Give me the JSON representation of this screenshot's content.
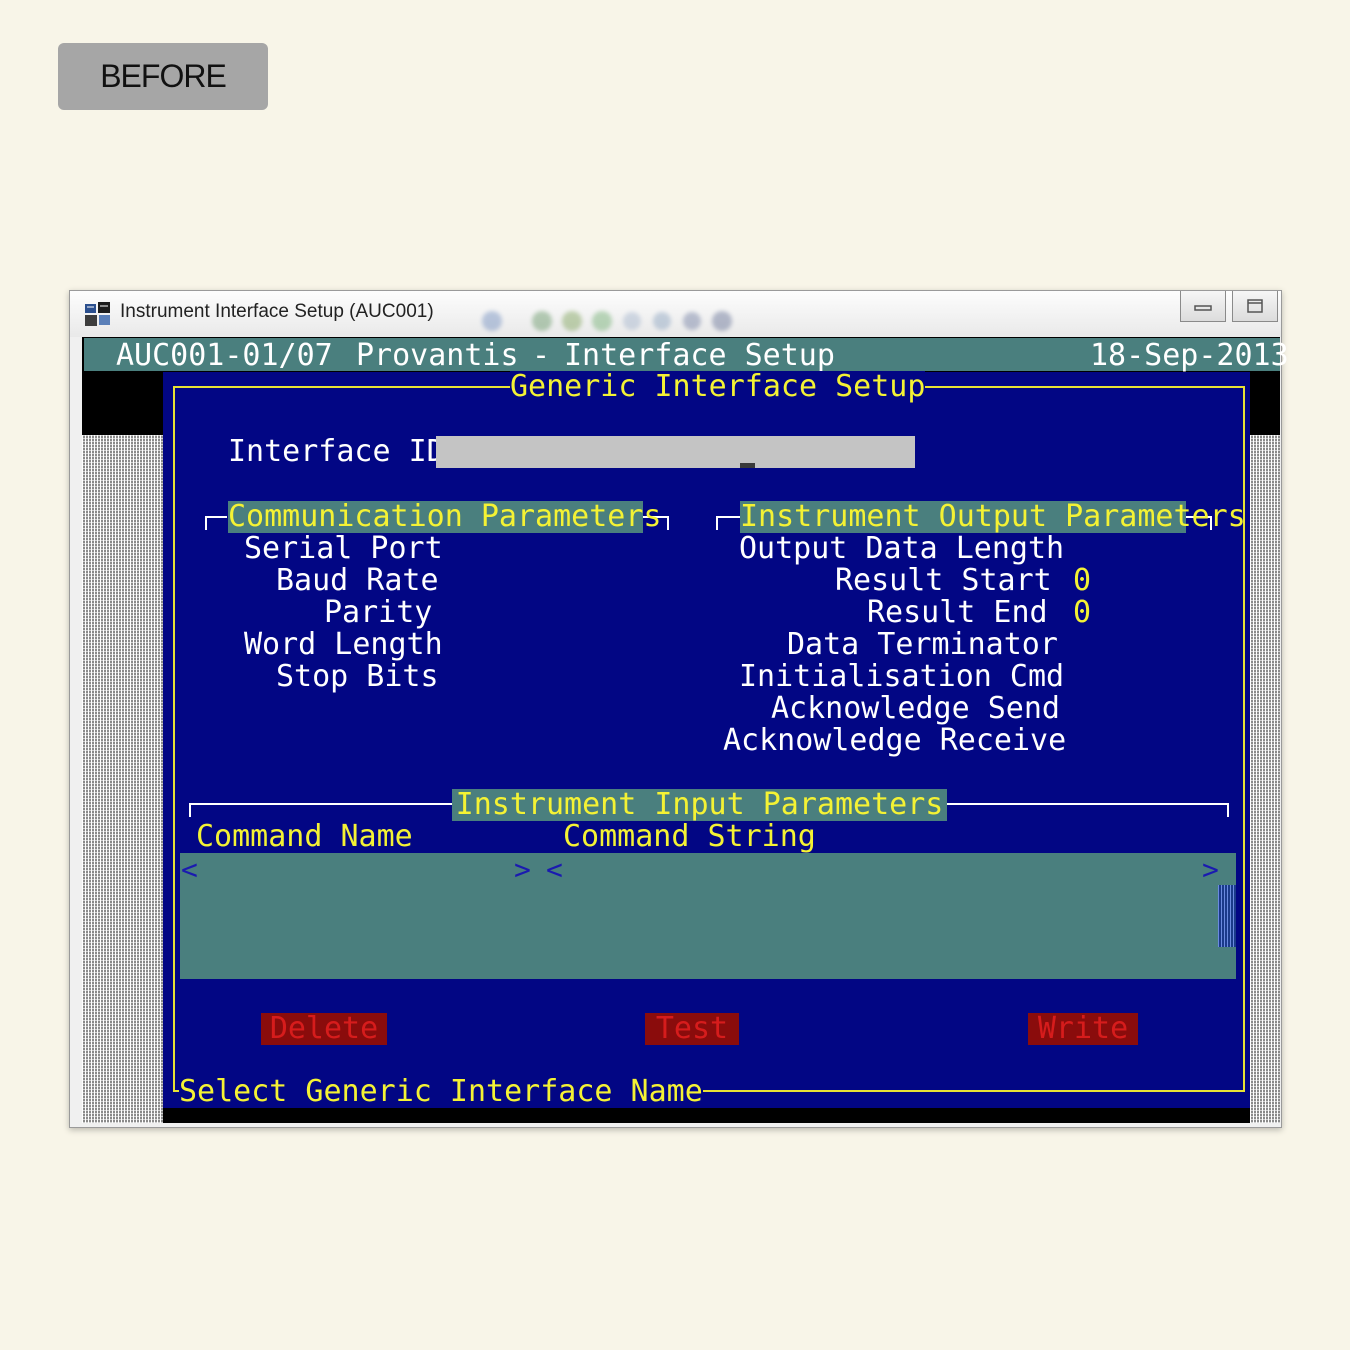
{
  "badge": {
    "label": "BEFORE"
  },
  "window": {
    "title": "Instrument Interface Setup (AUC001)",
    "icon": "app-grid-icon",
    "buttons": [
      "minimize-icon",
      "maximize-icon"
    ]
  },
  "header": {
    "screen_id": "AUC001-01/07",
    "app_name": "Provantis",
    "separator": "-",
    "screen_name": "Interface Setup",
    "date": "18-Sep-2013"
  },
  "panel": {
    "title": "Generic Interface Setup",
    "status_text": "Select Generic Interface Name"
  },
  "interface_id": {
    "label": "Interface ID",
    "value": ""
  },
  "communication": {
    "title": "Communication Parameters",
    "fields": [
      "Serial Port",
      "Baud Rate",
      "Parity",
      "Word Length",
      "Stop Bits"
    ]
  },
  "output": {
    "title": "Instrument Output Parameters",
    "fields": [
      {
        "label": "Output Data Length",
        "value": ""
      },
      {
        "label": "Result Start",
        "value": "0"
      },
      {
        "label": "Result End",
        "value": "0"
      },
      {
        "label": "Data Terminator",
        "value": ""
      },
      {
        "label": "Initialisation Cmd",
        "value": ""
      },
      {
        "label": "Acknowledge Send",
        "value": ""
      },
      {
        "label": "Acknowledge Receive",
        "value": ""
      }
    ]
  },
  "input_params": {
    "title": "Instrument Input Parameters",
    "col_name": "Command Name",
    "col_string": "Command String",
    "arrow_left": "<",
    "arrow_right": ">"
  },
  "actions": {
    "delete": "Delete",
    "test": "Test",
    "write": "Write"
  },
  "colors": {
    "screen_bg": "#020684",
    "teal": "#4a7f7e",
    "accent_yellow": "#f4f234",
    "button_bg": "#8a0c0c",
    "button_text": "#d61c1c"
  }
}
